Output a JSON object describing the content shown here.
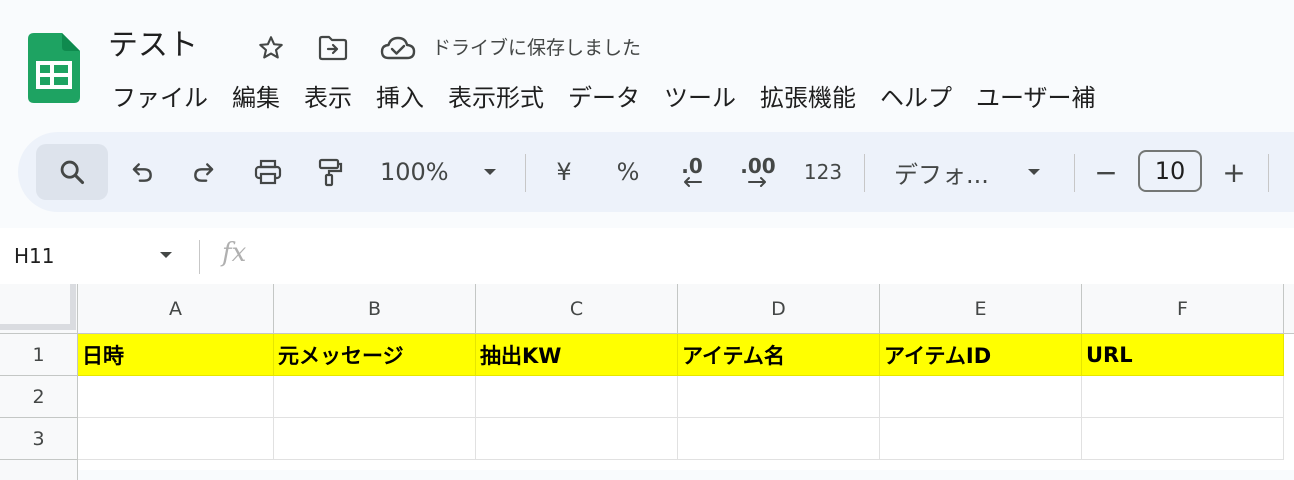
{
  "document": {
    "title": "テスト",
    "save_status": "ドライブに保存しました"
  },
  "menubar": {
    "items": [
      "ファイル",
      "編集",
      "表示",
      "挿入",
      "表示形式",
      "データ",
      "ツール",
      "拡張機能",
      "ヘルプ",
      "ユーザー補"
    ]
  },
  "toolbar": {
    "zoom": "100%",
    "currency_symbol": "¥",
    "percent_symbol": "%",
    "decrease_decimal_label": ".0",
    "increase_decimal_label": ".00",
    "number_format_label": "123",
    "font_name": "デフォ...",
    "font_size_minus": "−",
    "font_size": "10",
    "font_size_plus": "+"
  },
  "formula_bar": {
    "cell_reference": "H11",
    "fx_label": "fx",
    "content": ""
  },
  "grid": {
    "column_headers": [
      "A",
      "B",
      "C",
      "D",
      "E",
      "F"
    ],
    "row_headers": [
      "1",
      "2",
      "3"
    ],
    "highlight_color": "#ffff00",
    "rows": [
      [
        "日時",
        "元メッセージ",
        "抽出KW",
        "アイテム名",
        "アイテムID",
        "URL"
      ],
      [
        "",
        "",
        "",
        "",
        "",
        ""
      ],
      [
        "",
        "",
        "",
        "",
        "",
        ""
      ]
    ]
  },
  "colors": {
    "sheets_green": "#1ea362",
    "toolbar_bg": "#edf2fa",
    "app_bg": "#f9fbfd"
  }
}
